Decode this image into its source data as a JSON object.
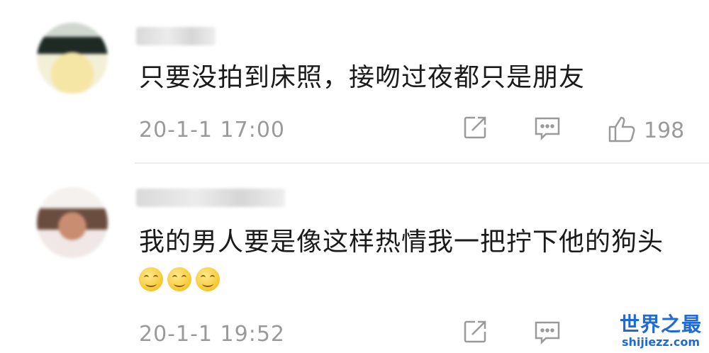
{
  "comments": [
    {
      "text": "只要没拍到床照，接吻过夜都只是朋友",
      "timestamp": "20-1-1 17:00",
      "likes": "198"
    },
    {
      "text": "我的男人要是像这样热情我一把拧下他的狗头",
      "emojis": [
        "smile-emoji",
        "smile-emoji",
        "smile-emoji"
      ],
      "timestamp": "20-1-1 19:52"
    }
  ],
  "icons": {
    "share": "share-icon",
    "comment": "comment-icon",
    "like": "thumbs-up-icon"
  },
  "watermark": {
    "title": "世界之最",
    "url": "shijiezz.com"
  },
  "colors": {
    "text": "#1a1a1a",
    "meta": "#9a9a9a",
    "watermark": "#1e6bd6"
  }
}
